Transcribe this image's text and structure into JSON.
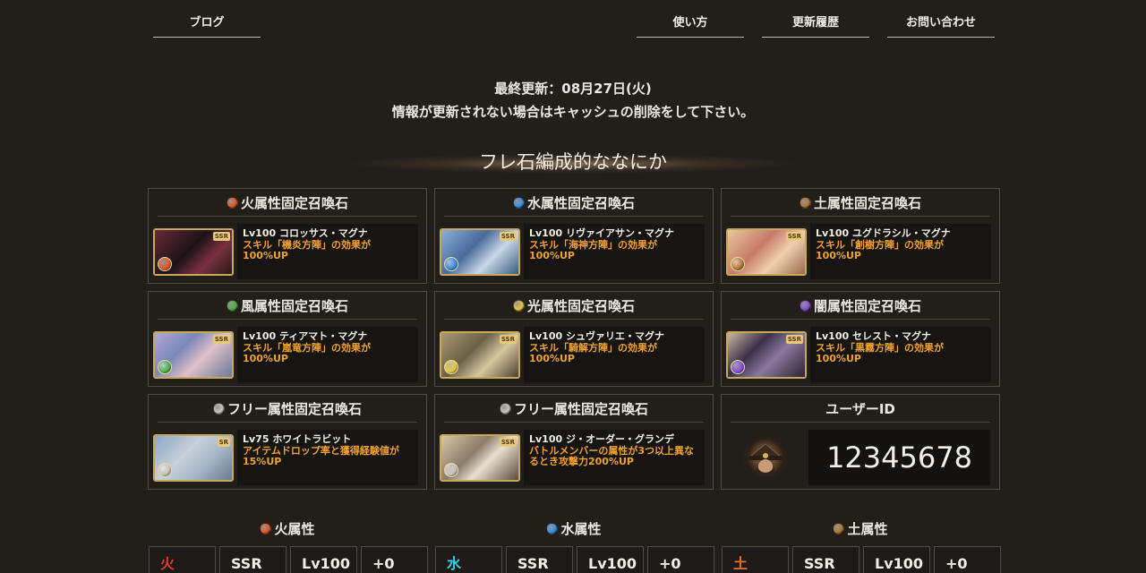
{
  "nav": {
    "blog": "ブログ",
    "usage": "使い方",
    "history": "更新履歴",
    "contact": "お問い合わせ"
  },
  "update": {
    "date": "最終更新：08月27日(火)",
    "cache_note": "情報が更新されない場合はキャッシュの削除をして下さい。"
  },
  "section_title": "フレ石編成的ななにか",
  "colors": {
    "fire": "#e2582a",
    "water": "#3a8fe0",
    "earth": "#b07a3a",
    "wind": "#4fb04a",
    "light": "#e8c840",
    "dark": "#8a50d8",
    "free": "#c8c4bc",
    "skill_text": "#f0a22a"
  },
  "stones": [
    {
      "header": "火属性固定召喚石",
      "orb": "fire",
      "rarity": "SSR",
      "name": "Lv100 コロッサス・マグナ",
      "skill": "スキル「機炎方陣」の効果が100%UP",
      "icon": "colossus-magna-icon"
    },
    {
      "header": "水属性固定召喚石",
      "orb": "water",
      "rarity": "SSR",
      "name": "Lv100 リヴァイアサン・マグナ",
      "skill": "スキル「海神方陣」の効果が100%UP",
      "icon": "leviathan-magna-icon"
    },
    {
      "header": "土属性固定召喚石",
      "orb": "earth",
      "rarity": "SSR",
      "name": "Lv100 ユグドラシル・マグナ",
      "skill": "スキル「創樹方陣」の効果が100%UP",
      "icon": "yggdrasil-magna-icon"
    },
    {
      "header": "風属性固定召喚石",
      "orb": "wind",
      "rarity": "SSR",
      "name": "Lv100 ティアマト・マグナ",
      "skill": "スキル「嵐竜方陣」の効果が100%UP",
      "icon": "tiamat-magna-icon"
    },
    {
      "header": "光属性固定召喚石",
      "orb": "light",
      "rarity": "SSR",
      "name": "Lv100 シュヴァリエ・マグナ",
      "skill": "スキル「騎解方陣」の効果が100%UP",
      "icon": "luminiera-magna-icon"
    },
    {
      "header": "闇属性固定召喚石",
      "orb": "dark",
      "rarity": "SSR",
      "name": "Lv100 セレスト・マグナ",
      "skill": "スキル「黒霧方陣」の効果が100%UP",
      "icon": "celeste-magna-icon"
    },
    {
      "header": "フリー属性固定召喚石",
      "orb": "free",
      "rarity": "SR",
      "name": "Lv75 ホワイトラビット",
      "skill": "アイテムドロップ率と獲得経験値が15%UP",
      "icon": "white-rabbit-icon"
    },
    {
      "header": "フリー属性固定召喚石",
      "orb": "free",
      "rarity": "SSR",
      "name": "Lv100 ジ・オーダー・グランデ",
      "skill": "バトルメンバーの属性が3つ以上異なるとき攻撃力200%UP",
      "icon": "grand-order-icon"
    }
  ],
  "user": {
    "header": "ユーザーID",
    "id": "12345678"
  },
  "attributes": [
    {
      "title": "火属性",
      "orb": "fire",
      "element": "火",
      "element_color": "#e23a2a",
      "rarity": "SSR",
      "level": "Lv100",
      "plus": "+0"
    },
    {
      "title": "水属性",
      "orb": "water",
      "element": "水",
      "element_color": "#35d0e8",
      "rarity": "SSR",
      "level": "Lv100",
      "plus": "+0"
    },
    {
      "title": "土属性",
      "orb": "earth",
      "element": "土",
      "element_color": "#e8702a",
      "rarity": "SSR",
      "level": "Lv100",
      "plus": "+0"
    }
  ]
}
